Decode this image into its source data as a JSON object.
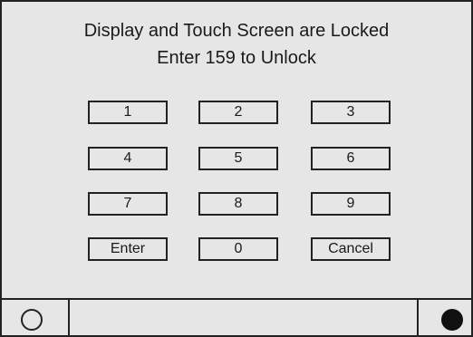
{
  "message": {
    "line1": "Display and Touch Screen are Locked",
    "line2": "Enter 159 to Unlock"
  },
  "keypad": {
    "keys": [
      "1",
      "2",
      "3",
      "4",
      "5",
      "6",
      "7",
      "8",
      "9",
      "Enter",
      "0",
      "Cancel"
    ]
  },
  "bottom_bar": {
    "left_icon": "open-circle-icon",
    "right_icon": "filled-circle-icon"
  }
}
